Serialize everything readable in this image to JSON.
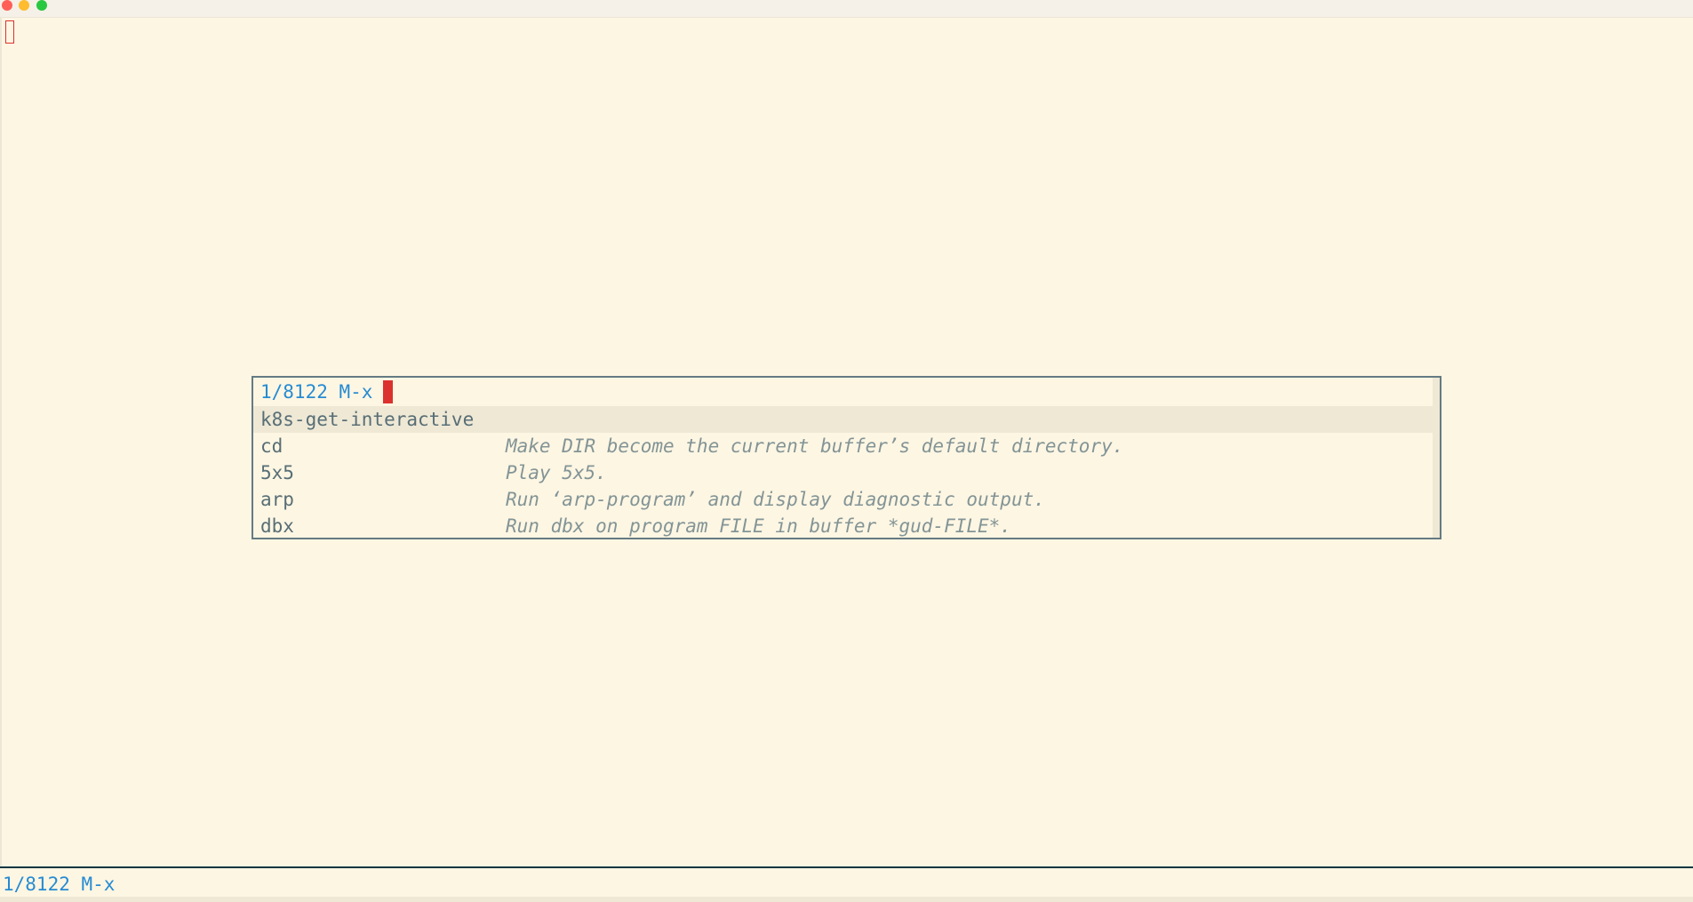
{
  "minibuffer": {
    "prompt": "1/8122 M-x"
  },
  "candidates": [
    {
      "name": "k8s-get-interactive",
      "doc": "",
      "selected": true
    },
    {
      "name": "cd",
      "doc": "Make DIR become the current buffer’s default directory.",
      "selected": false
    },
    {
      "name": "5x5",
      "doc": "Play 5x5.",
      "selected": false
    },
    {
      "name": "arp",
      "doc": "Run ‘arp-program’ and display diagnostic output.",
      "selected": false
    },
    {
      "name": "dbx",
      "doc": "Run dbx on program FILE in buffer *gud-FILE*.",
      "selected": false
    }
  ],
  "echo_area": {
    "text": "1/8122 M-x"
  },
  "colors": {
    "background": "#fdf6e3",
    "prompt": "#268bd2",
    "cursor": "#dc322f",
    "selection": "#eee8d5",
    "candidate": "#586e75",
    "annotation": "#839496"
  }
}
